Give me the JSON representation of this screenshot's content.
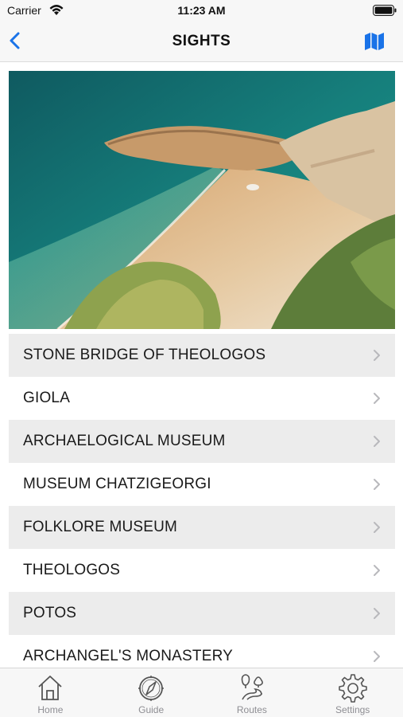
{
  "status_bar": {
    "carrier": "Carrier",
    "time": "11:23 AM"
  },
  "nav": {
    "title": "SIGHTS",
    "back_icon": "chevron-left-icon",
    "map_icon": "map-icon",
    "accent_color": "#1a73e8"
  },
  "hero": {
    "subject": "coastal-beach-photo"
  },
  "sights": [
    {
      "label": "STONE BRIDGE OF THEOLOGOS"
    },
    {
      "label": "GIOLA"
    },
    {
      "label": "ARCHAELOGICAL MUSEUM"
    },
    {
      "label": "MUSEUM CHATZIGEORGI"
    },
    {
      "label": "FOLKLORE MUSEUM"
    },
    {
      "label": "THEOLOGOS"
    },
    {
      "label": "POTOS"
    },
    {
      "label": "ARCHANGEL'S MONASTERY"
    }
  ],
  "tabs": [
    {
      "label": "Home",
      "icon": "home-icon"
    },
    {
      "label": "Guide",
      "icon": "compass-icon"
    },
    {
      "label": "Routes",
      "icon": "routes-icon"
    },
    {
      "label": "Settings",
      "icon": "gear-icon"
    }
  ]
}
